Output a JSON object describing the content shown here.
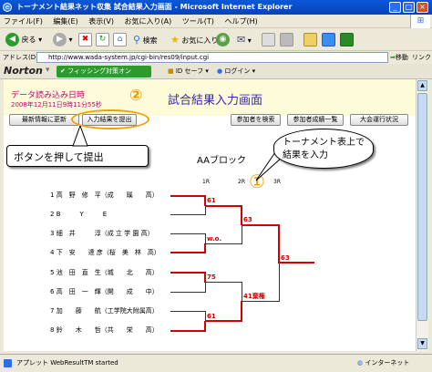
{
  "window": {
    "title": "トーナメント結果ネット収集 試合結果入力画面 - Microsoft Internet Explorer",
    "minimize": "_",
    "maximize": "□",
    "close": "×"
  },
  "menu": [
    "ファイル(F)",
    "編集(E)",
    "表示(V)",
    "お気に入り(A)",
    "ツール(T)",
    "ヘルプ(H)"
  ],
  "toolbar": {
    "back": "戻る",
    "search": "検索",
    "favorites": "お気に入り"
  },
  "address": {
    "label": "アドレス(D)",
    "url": "http://www.wada-system.jp/cgi-bin/res09/input.cgi",
    "go": "移動",
    "links": "リンク"
  },
  "norton": {
    "brand": "Norton",
    "phishing": "フィッシング対策オン",
    "id_safe": "ID セーフ",
    "login": "ログイン"
  },
  "page": {
    "load_label": "データ読み込み日時",
    "load_time": "2008年12月11日9時11分55秒",
    "title": "試合結果入力画面",
    "step1": "①",
    "step2": "②",
    "buttons": {
      "refresh": "最新情報に更新",
      "submit": "入力結果を提出",
      "search": "参加者を検索",
      "list": "参加者成績一覧",
      "progress": "大会運行状況"
    },
    "block": "AAブロック",
    "rounds": [
      "1R",
      "2R",
      "3R"
    ],
    "players": [
      {
        "no": "1",
        "name": "高　野　修　平（成　　蹊　　高）"
      },
      {
        "no": "2",
        "name": "B　　　Y　　　E"
      },
      {
        "no": "3",
        "name": "細　井　　　淳（成 立 学 園 高）"
      },
      {
        "no": "4",
        "name": "下　安　　達 彦（桜　美　林　高）"
      },
      {
        "no": "5",
        "name": "池　田　直　生（城　　北　　高）"
      },
      {
        "no": "6",
        "name": "高　田　一　輝（開　　成　　中）"
      },
      {
        "no": "7",
        "name": "加　　藤　　航（工学院大附属高）"
      },
      {
        "no": "8",
        "name": "鈴　　木　　哲（共　　栄　　高）"
      }
    ],
    "scores": {
      "r1a": "61",
      "r1b": "w.o.",
      "r1c": "75",
      "r1d": "61",
      "r2a": "63",
      "r2b": "41棄権",
      "r3a": "63"
    }
  },
  "annotations": {
    "callout1": "トーナメント表上で結果を入力",
    "callout2": "ボタンを押して提出"
  },
  "status": {
    "text": "アプレット WebResultTM started",
    "zone": "インターネット"
  }
}
